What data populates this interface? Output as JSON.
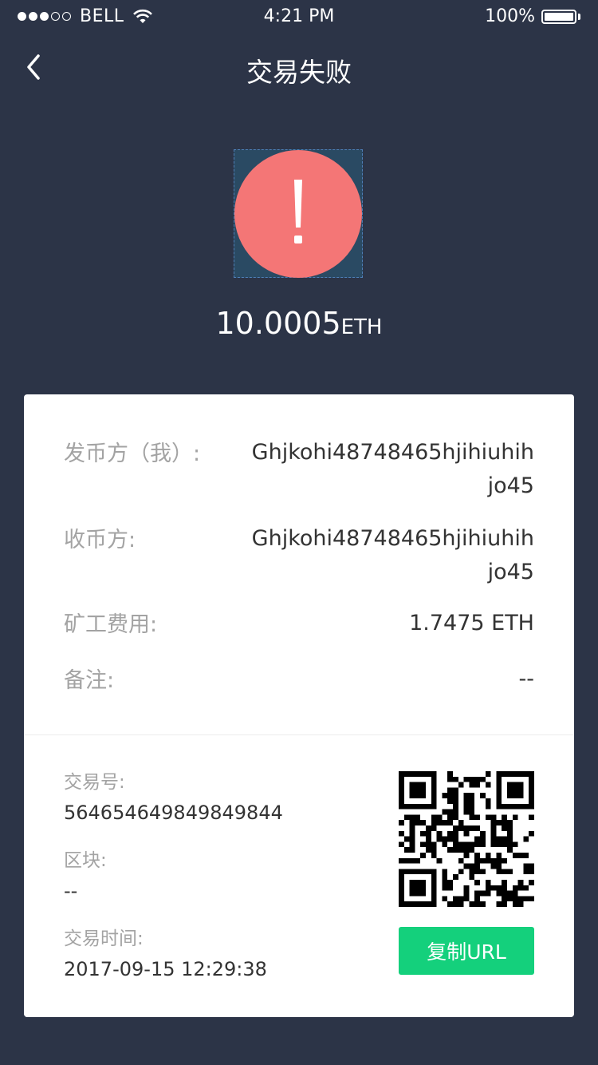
{
  "status_bar": {
    "carrier": "BELL",
    "time": "4:21 PM",
    "battery": "100%"
  },
  "nav": {
    "title": "交易失败"
  },
  "summary": {
    "amount": "10.0005",
    "unit": "ETH"
  },
  "details": {
    "sender_label": "发币方（我）:",
    "sender_value": "Ghjkohi48748465hjihiuhihjo45",
    "receiver_label": "收币方:",
    "receiver_value": "Ghjkohi48748465hjihiuhihjo45",
    "fee_label": "矿工费用:",
    "fee_value": "1.7475 ETH",
    "note_label": "备注:",
    "note_value": "--"
  },
  "transaction": {
    "tx_label": "交易号:",
    "tx_value": "564654649849849844",
    "block_label": "区块:",
    "block_value": "--",
    "time_label": "交易时间:",
    "time_value": "2017-09-15 12:29:38"
  },
  "actions": {
    "copy_url": "复制URL"
  },
  "colors": {
    "background": "#2c3447",
    "alert": "#f47676",
    "button": "#14d07c"
  }
}
